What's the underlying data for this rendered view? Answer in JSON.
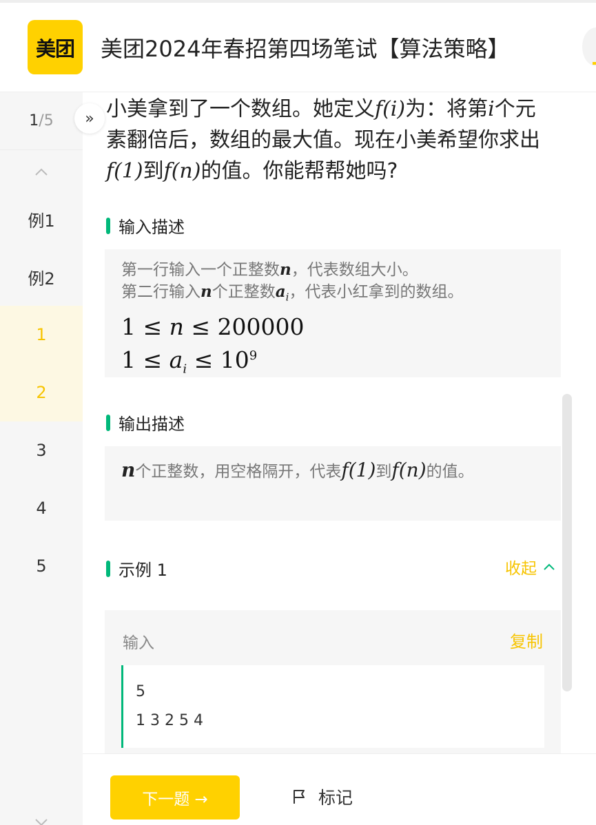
{
  "header": {
    "logo_text": "美团",
    "title": "美团2024年春招第四场笔试【算法策略】"
  },
  "sidebar": {
    "current": "1",
    "total": "5",
    "items": [
      {
        "label": "例1",
        "active": false
      },
      {
        "label": "例2",
        "active": false
      },
      {
        "label": "1",
        "active": true
      },
      {
        "label": "2",
        "active": true
      },
      {
        "label": "3",
        "active": false
      },
      {
        "label": "4",
        "active": false
      },
      {
        "label": "5",
        "active": false
      }
    ]
  },
  "question": {
    "p1": "小美拿到了一个数组。她定义",
    "f_i": "f(i)",
    "p2": "为：将第",
    "i": "i",
    "p3": "个元素翻倍后，数组的最大值。现在小美希望你求出",
    "f_1": "f(1)",
    "p4": "到",
    "f_n": "f(n)",
    "p5": "的值。你能帮帮她吗?"
  },
  "input_section": {
    "title": "输入描述",
    "line1_a": "第一行输入一个正整数",
    "line1_var": "n",
    "line1_b": "，代表数组大小。",
    "line2_a": "第二行输入",
    "line2_var": "n",
    "line2_b": "个正整数",
    "line2_var2": "a",
    "line2_sub": "i",
    "line2_c": "，代表小红拿到的数组。",
    "c1_lhs": "1 ≤ ",
    "c1_var": "n",
    "c1_rhs": " ≤ 200000",
    "c2_lhs": "1 ≤ ",
    "c2_var": "a",
    "c2_sub": "i",
    "c2_mid": " ≤ 10",
    "c2_sup": "9"
  },
  "output_section": {
    "title": "输出描述",
    "var_n": "n",
    "text_a": "个正整数，用空格隔开，代表",
    "f_1": "f(1)",
    "text_b": "到",
    "f_n": "f(n)",
    "text_c": "的值。"
  },
  "example": {
    "title": "示例 1",
    "collapse_label": "收起",
    "input_label": "输入",
    "copy_label": "复制",
    "input_lines": [
      "5",
      "1 3 2 5 4"
    ]
  },
  "footer": {
    "next_label": "下一题 →",
    "mark_label": "标记"
  },
  "colors": {
    "accent": "#ffd100",
    "green": "#00b87a",
    "active_text": "#f7c400"
  }
}
